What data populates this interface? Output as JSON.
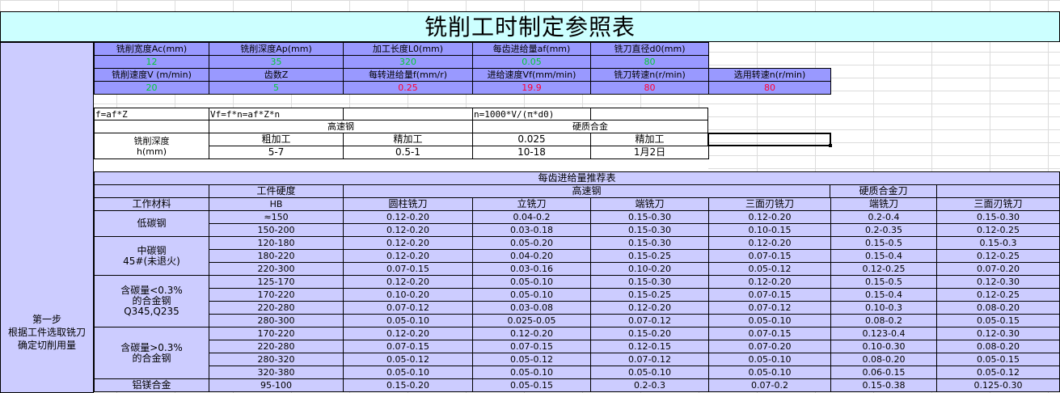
{
  "title": "铣削工时制定参照表",
  "step": {
    "l1": "第一步",
    "l2": "根据工件选取铣刀",
    "l3": "确定切削用量"
  },
  "params": {
    "row1": {
      "h": [
        "铣削宽度Ac(mm)",
        "铣削深度Ap(mm)",
        "加工长度L0(mm)",
        "每齿进给量af(mm)",
        "铣刀直径d0(mm)"
      ],
      "v": [
        "12",
        "35",
        "320",
        "0.05",
        "80"
      ]
    },
    "row2": {
      "h": [
        "铣削速度V (m/min)",
        "齿数Z",
        "每转进给量f(mm/r)",
        "进给速度Vf(mm/min)",
        "铣刀转速n(r/min)",
        "选用转速n(r/min)"
      ],
      "v": [
        "20",
        "5",
        "0.25",
        "19.9",
        "80",
        "80"
      ]
    }
  },
  "formulas": {
    "f1": "f=af*Z",
    "f2": "Vf=f*n=af*Z*n",
    "f3": "n=1000*V/(π*d0)"
  },
  "depth": {
    "g_hss": "高速钢",
    "g_carbide": "硬质合金",
    "label1": "铣削深度",
    "label2": "h(mm)",
    "heads": [
      "粗加工",
      "精加工",
      "0.025",
      "精加工"
    ],
    "vals": [
      "5-7",
      "0.5-1",
      "10-18",
      "1月2日"
    ]
  },
  "feed": {
    "title": "每齿进给量推荐表",
    "hardness": "工件硬度",
    "hss": "高速钢",
    "carbide": "硬质合金刀",
    "material": "工作材料",
    "hb": "HB",
    "cols": [
      "圆柱铣刀",
      "立铣刀",
      "端铣刀",
      "三面刃铣刀",
      "端铣刀",
      "三面刃铣刀"
    ],
    "groups": [
      {
        "name": [
          "低碳钢"
        ],
        "rows": [
          [
            "≈150",
            "0.12-0.20",
            "0.04-0.2",
            "0.15-0.30",
            "0.12-0.20",
            "0.2-0.4",
            "0.15-0.30"
          ],
          [
            "150-200",
            "0.12-0.20",
            "0.03-0.18",
            "0.15-0.30",
            "0.10-0.15",
            "0.2-0.35",
            "0.12-0.25"
          ]
        ]
      },
      {
        "name": [
          "中碳钢",
          "45#(未退火)"
        ],
        "rows": [
          [
            "120-180",
            "0.12-0.20",
            "0.05-0.20",
            "0.15-0.30",
            "0.12-0.20",
            "0.15-0.5",
            "0.15-0.3"
          ],
          [
            "180-220",
            "0.12-0.20",
            "0.04-0.20",
            "0.15-0.25",
            "0.07-0.15",
            "0.15-0.4",
            "0.12-0.25"
          ],
          [
            "220-300",
            "0.07-0.15",
            "0.03-0.16",
            "0.10-0.20",
            "0.05-0.12",
            "0.12-0.25",
            "0.07-0.20"
          ]
        ]
      },
      {
        "name": [
          "含碳量<0.3%",
          "的合金钢",
          "Q345,Q235"
        ],
        "rows": [
          [
            "125-170",
            "0.12-0.20",
            "0.05-0.10",
            "0.15-0.30",
            "0.12-0.20",
            "0.15-0.5",
            "0.12-0.30"
          ],
          [
            "170-220",
            "0.10-0.20",
            "0.05-0.10",
            "0.15-0.25",
            "0.07-0.15",
            "0.15-0.4",
            "0.12-0.25"
          ],
          [
            "220-280",
            "0.07-0.12",
            "0.03-0.08",
            "0.12-0.20",
            "0.07-0.12",
            "0.10-0.3",
            "0.08-0.20"
          ],
          [
            "280-300",
            "0.05-0.10",
            "0.025-0.05",
            "0.07-0.12",
            "0.05-0.10",
            "0.08-0.2",
            "0.05-0.15"
          ]
        ]
      },
      {
        "name": [
          "含碳量>0.3%",
          "的合金钢"
        ],
        "rows": [
          [
            "170-220",
            "0.12-0.20",
            "0.12-0.20",
            "0.15-0.20",
            "0.07-0.15",
            "0.123-0.4",
            "0.12-0.30"
          ],
          [
            "220-280",
            "0.07-0.15",
            "0.07-0.15",
            "0.12-0.15",
            "0.07-0.20",
            "0.10-0.30",
            "0.08-0.20"
          ],
          [
            "280-320",
            "0.05-0.12",
            "0.05-0.12",
            "0.07-0.12",
            "0.05-0.10",
            "0.08-0.20",
            "0.05-0.15"
          ],
          [
            "320-380",
            "0.05-0.10",
            "0.05-0.10",
            "0.05-0.10",
            "0.05-0.10",
            "0.06-0.15",
            "0.05-0.12"
          ]
        ]
      },
      {
        "name": [
          "铝镁合金"
        ],
        "rows": [
          [
            "95-100",
            "0.15-0.20",
            "0.05-0.15",
            "0.2-0.3",
            "0.07-0.2",
            "0.15-0.38",
            "0.125-0.30"
          ]
        ]
      }
    ]
  }
}
